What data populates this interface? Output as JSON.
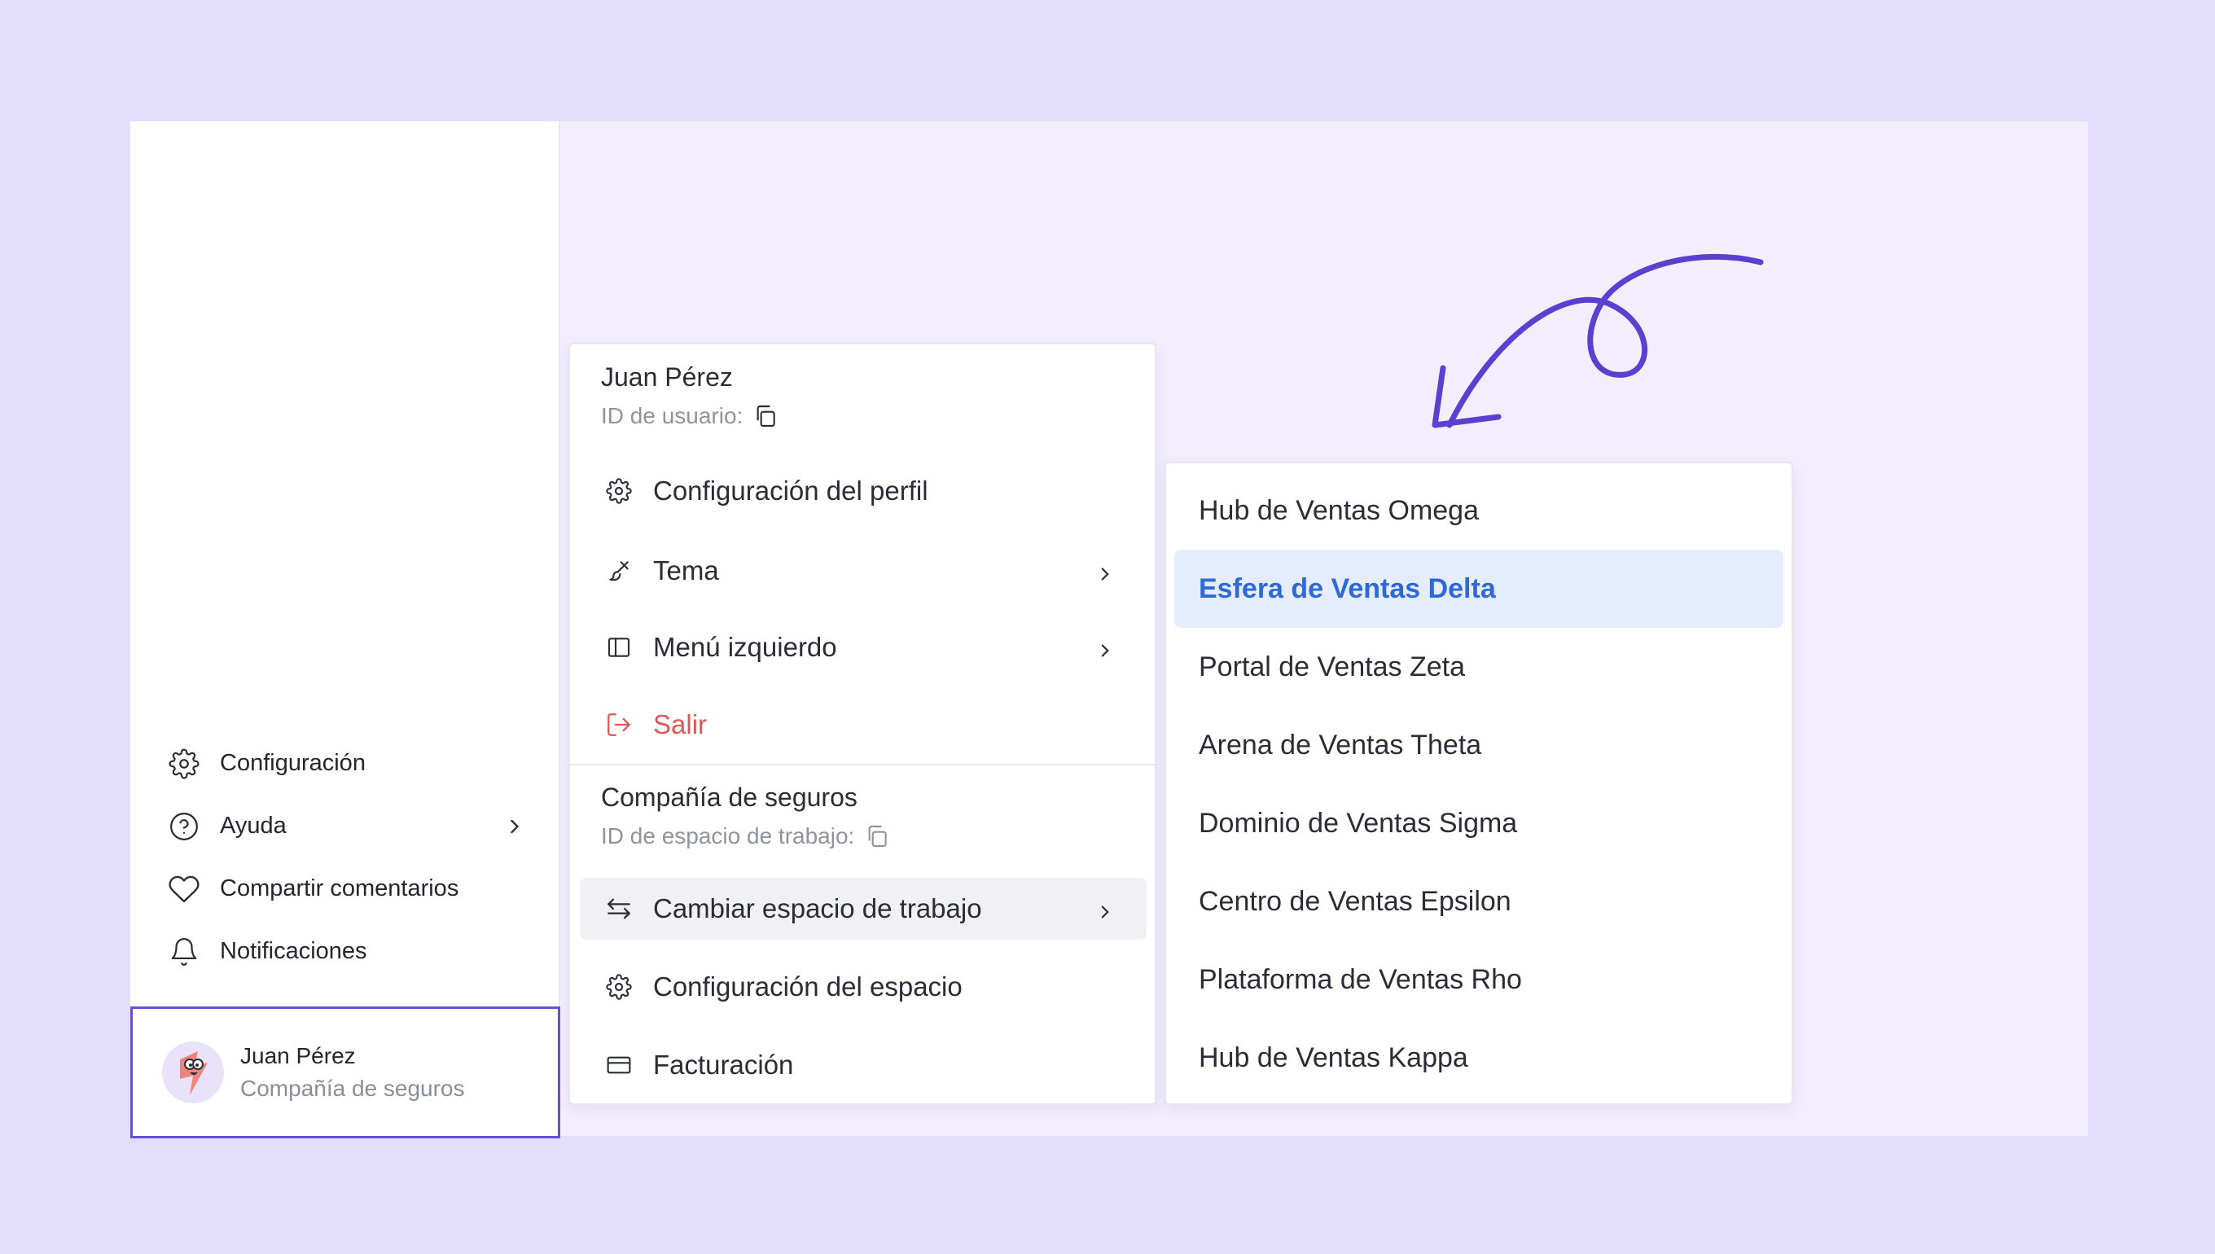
{
  "sidebar": {
    "items": [
      {
        "label": "Configuración",
        "icon": "gear-icon"
      },
      {
        "label": "Ayuda",
        "icon": "help-circle-icon"
      },
      {
        "label": "Compartir comentarios",
        "icon": "heart-icon"
      },
      {
        "label": "Notificaciones",
        "icon": "bell-icon"
      }
    ],
    "user": {
      "name": "Juan Pérez",
      "company": "Compañía de seguros"
    }
  },
  "profile_menu": {
    "name": "Juan Pérez",
    "user_id_label": "ID de usuario:",
    "items": [
      {
        "label": "Configuración del perfil",
        "icon": "gear-icon"
      },
      {
        "label": "Tema",
        "icon": "brush-icon"
      },
      {
        "label": "Menú izquierdo",
        "icon": "sidebar-icon"
      },
      {
        "label": "Salir",
        "icon": "logout-icon"
      }
    ],
    "workspace_name": "Compañía de seguros",
    "workspace_id_label": "ID de espacio de trabajo:",
    "workspace_items": [
      {
        "label": "Cambiar espacio de trabajo",
        "icon": "switch-arrows-icon"
      },
      {
        "label": "Configuración del espacio",
        "icon": "gear-icon"
      },
      {
        "label": "Facturación",
        "icon": "credit-card-icon"
      }
    ]
  },
  "workspace_menu": {
    "items": [
      "Hub de Ventas Omega",
      "Esfera de Ventas Delta",
      "Portal de Ventas Zeta",
      "Arena de Ventas Theta",
      "Dominio de Ventas Sigma",
      "Centro de Ventas Epsilon",
      "Plataforma de Ventas Rho",
      "Hub de Ventas Kappa"
    ],
    "selected": "Esfera de Ventas Delta"
  },
  "colors": {
    "background": "#e3defc",
    "accent": "#6a4fd0",
    "selected_bg": "#e4ecfd",
    "selected_text": "#2e6ad6",
    "danger": "#e05658"
  }
}
